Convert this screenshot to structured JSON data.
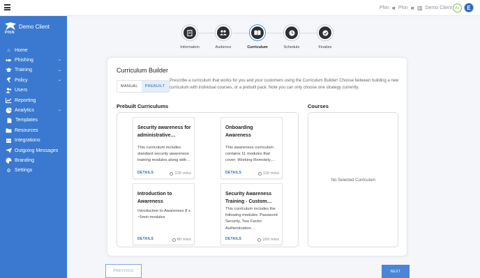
{
  "topbar": {
    "menu_icon": "hamburger-icon",
    "breadcrumbs": [
      "Phin",
      "Phin",
      "Demo Client"
    ],
    "status": "A+",
    "avatar_initial": "E"
  },
  "sidebar": {
    "client_name": "Demo Client",
    "logo_text": "PHIN",
    "items": [
      {
        "label": "Home",
        "icon": "home-icon"
      },
      {
        "label": "Phishing",
        "icon": "fish-icon",
        "expandable": true
      },
      {
        "label": "Training",
        "icon": "graduation-cap-icon",
        "expandable": true
      },
      {
        "label": "Policy",
        "icon": "gavel-icon",
        "expandable": true
      },
      {
        "label": "Users",
        "icon": "users-icon"
      },
      {
        "label": "Reporting",
        "icon": "chart-line-icon"
      },
      {
        "label": "Analytics",
        "icon": "pie-chart-icon",
        "expandable": true
      },
      {
        "label": "Templates",
        "icon": "file-icon"
      },
      {
        "label": "Resources",
        "icon": "folder-icon"
      },
      {
        "label": "Integrations",
        "icon": "plug-icon"
      },
      {
        "label": "Outgoing Messages",
        "icon": "paper-plane-icon"
      },
      {
        "label": "Branding",
        "icon": "palette-icon"
      },
      {
        "label": "Settings",
        "icon": "gear-icon"
      }
    ]
  },
  "steps": [
    {
      "label": "Information",
      "icon": "document-icon"
    },
    {
      "label": "Audience",
      "icon": "users-icon"
    },
    {
      "label": "Curriculum",
      "icon": "book-icon",
      "active": true
    },
    {
      "label": "Schedule",
      "icon": "clock-icon"
    },
    {
      "label": "Finalize",
      "icon": "check-icon"
    }
  ],
  "builder": {
    "title": "Curriculum Builder",
    "tab_manual": "MANUAL",
    "tab_prebuilt": "PREBUILT",
    "description": "Prescribe a curriculum that works for you and your customers using the Curriculum Builder! Choose between building a new curriculum with individual courses, or a prebuilt pack. Note you can only choose one strategy currently.",
    "prebuilt_heading": "Prebuilt Curriculums",
    "courses_heading": "Courses",
    "empty_courses": "No Selected Curriculum",
    "curriculums": [
      {
        "title": "Security awareness for administrative…",
        "description": "This curriculum includes standard security awareness training modules along with…",
        "details": "DETAILS",
        "duration": "120 mins"
      },
      {
        "title": "Onboarding Awareness",
        "description": "This awareness curriculum contains 11 modules that cover: Working Remotely,…",
        "details": "DETAILS",
        "duration": "110 mins"
      },
      {
        "title": "Introduction to Awareness",
        "description": "Introduction to Awareness 8 x ~5min modules",
        "details": "DETAILS",
        "duration": "80 mins"
      },
      {
        "title": "Security Awareness Training - Custom…",
        "description": "This curriculum includes the following modules: Password Security, Two Factor Authentication…",
        "details": "DETAILS",
        "duration": "160 mins"
      }
    ]
  },
  "footer": {
    "previous": "PREVIOUS",
    "next": "NEXT"
  },
  "colors": {
    "sidebar": "#3a79cf",
    "accent": "#2f67b8",
    "next_button": "#4a85d8"
  }
}
